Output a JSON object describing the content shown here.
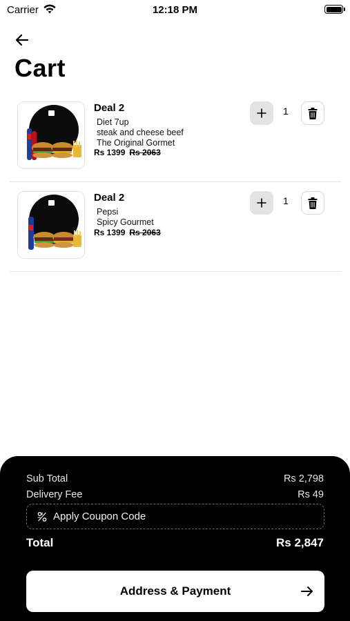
{
  "status_bar": {
    "carrier": "Carrier",
    "time": "12:18 PM"
  },
  "header": {
    "title": "Cart"
  },
  "cart": {
    "items": [
      {
        "name": "Deal 2",
        "options": [
          "Diet 7up",
          "steak and cheese beef",
          "The Original Gormet"
        ],
        "price": "Rs 1399",
        "original_price": "Rs 2063",
        "quantity": "1"
      },
      {
        "name": "Deal 2",
        "options": [
          "Pepsi",
          "Spicy Gourmet"
        ],
        "price": "Rs 1399",
        "original_price": "Rs 2063",
        "quantity": "1"
      }
    ]
  },
  "summary": {
    "subtotal_label": "Sub Total",
    "subtotal_value": "Rs 2,798",
    "delivery_label": "Delivery Fee",
    "delivery_value": "Rs 49",
    "coupon_label": "Apply Coupon Code",
    "total_label": "Total",
    "total_value": "Rs 2,847"
  },
  "cta": {
    "label": "Address & Payment"
  }
}
